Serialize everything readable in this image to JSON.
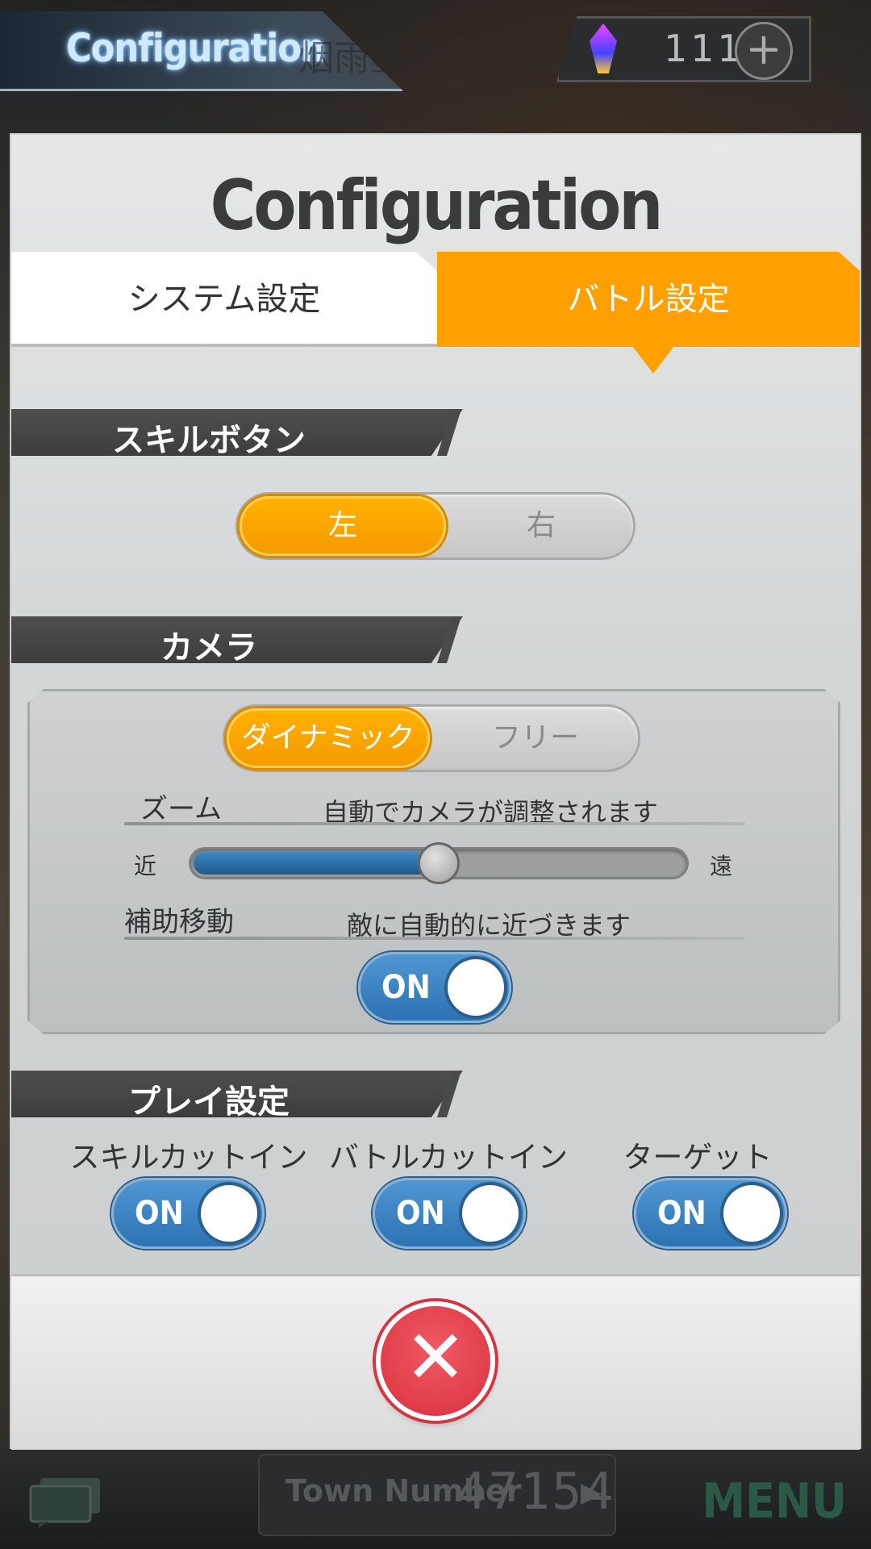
{
  "header": {
    "screen_title": "Configuration",
    "player_name": "烟雨墨白",
    "currency_count": "111",
    "add_currency_symbol": "+"
  },
  "dialog": {
    "title": "Configuration",
    "tabs": [
      {
        "label": "システム設定",
        "active": false
      },
      {
        "label": "バトル設定",
        "active": true
      }
    ],
    "skill_button": {
      "section": "スキルボタン",
      "options": [
        "左",
        "右"
      ],
      "selected": "左"
    },
    "camera": {
      "section": "カメラ",
      "modes": [
        "ダイナミック",
        "フリー"
      ],
      "selected_mode": "ダイナミック",
      "zoom": {
        "label": "ズーム",
        "description": "自動でカメラが調整されます",
        "near_label": "近",
        "far_label": "遠",
        "level": 0.5
      },
      "assist": {
        "label": "補助移動",
        "description": "敵に自動的に近づきます",
        "state": "ON"
      }
    },
    "play": {
      "section": "プレイ設定",
      "toggles": [
        {
          "label": "スキルカットイン",
          "state": "ON"
        },
        {
          "label": "バトルカットイン",
          "state": "ON"
        },
        {
          "label": "ターゲット",
          "state": "ON"
        }
      ]
    },
    "close_symbol": "✕"
  },
  "bottom_bar": {
    "town_label": "Town Number",
    "town_number": "47154",
    "town_arrow": "▶",
    "menu_label": "MENU"
  },
  "colors": {
    "accent_orange": "#ffa000",
    "switch_blue": "#2d72b2",
    "close_red": "#d8303e"
  }
}
